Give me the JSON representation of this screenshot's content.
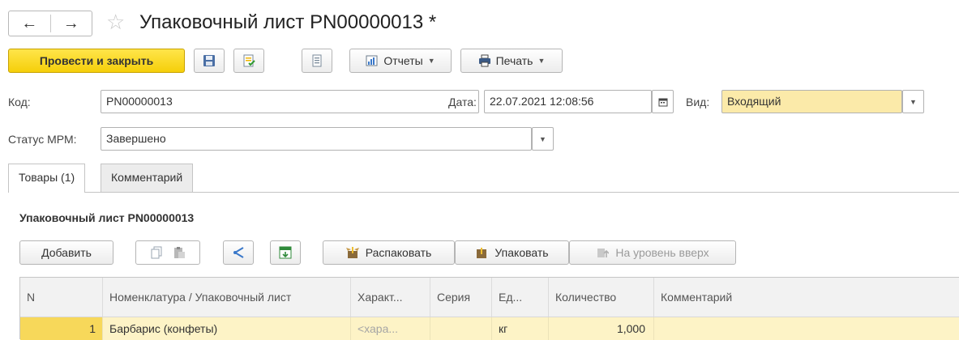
{
  "window": {
    "back_icon": "arrow-left-icon",
    "forward_icon": "arrow-right-icon",
    "favorite_icon": "star-outline-icon",
    "title": "Упаковочный лист PN00000013 *"
  },
  "toolbar": {
    "post_close_label": "Провести и закрыть",
    "save_icon": "save-icon",
    "post_icon": "post-document-icon",
    "list_icon": "document-list-icon",
    "reports_label": "Отчеты",
    "print_label": "Печать"
  },
  "form": {
    "code_label": "Код:",
    "code_value": "PN00000013",
    "date_label": "Дата:",
    "date_value": "22.07.2021 12:08:56",
    "kind_label": "Вид:",
    "kind_value": "Входящий",
    "status_label": "Статус МРМ:",
    "status_value": "Завершено"
  },
  "tabs": [
    {
      "label": "Товары (1)",
      "active": true
    },
    {
      "label": "Комментарий",
      "active": false
    }
  ],
  "section_title": "Упаковочный лист PN00000013",
  "table_toolbar": {
    "add_label": "Добавить",
    "unpack_label": "Распаковать",
    "pack_label": "Упаковать",
    "level_up_label": "На уровень вверх"
  },
  "table": {
    "columns": [
      "N",
      "Номенклатура / Упаковочный лист",
      "Характ...",
      "Серия",
      "Ед...",
      "Количество",
      "Комментарий"
    ],
    "rows": [
      {
        "n": "1",
        "item": "Барбарис (конфеты)",
        "characteristic": "<хара...",
        "series": "",
        "unit": "кг",
        "quantity": "1,000",
        "comment": ""
      }
    ]
  },
  "colors": {
    "primary_button": "#f5cf0a",
    "selected_field": "#fbeaa9",
    "selected_row": "#fdf3c6"
  }
}
